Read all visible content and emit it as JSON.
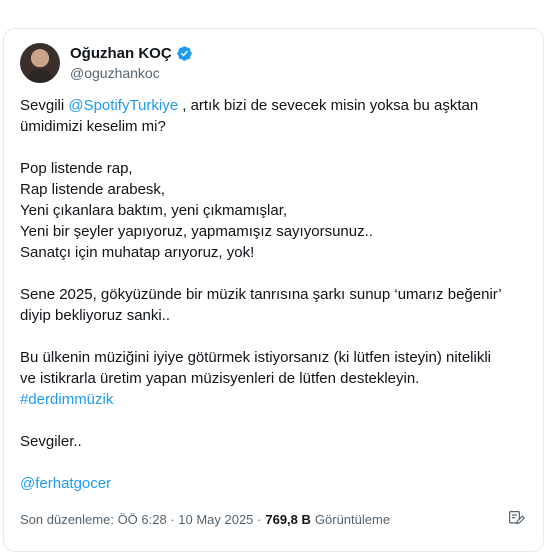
{
  "author": {
    "display_name": "Oğuzhan KOÇ",
    "handle": "@oguzhankoc"
  },
  "post": {
    "p1": {
      "before": "Sevgili ",
      "mention": "@SpotifyTurkiye",
      "after": " , artık bizi de sevecek misin yoksa bu aşktan",
      "line2": "ümidimizi keselim mi?"
    },
    "p2": [
      "Pop listende rap,",
      "Rap listende arabesk,",
      "Yeni çıkanlara baktım, yeni çıkmamışlar,",
      "Yeni bir şeyler yapıyoruz, yapmamışız sayıyorsunuz..",
      "Sanatçı için muhatap arıyoruz, yok!"
    ],
    "p3": [
      "Sene 2025, gökyüzünde bir müzik tanrısına şarkı sunup ‘umarız beğenir’",
      "diyip bekliyoruz sanki.."
    ],
    "p4": [
      "Bu ülkenin müziğini iyiye götürmek istiyorsanız (ki lütfen isteyin) nitelikli",
      "ve istikrarla üretim yapan müzisyenleri de lütfen destekleyin."
    ],
    "hashtag": "#derdimmüzik",
    "closing": "Sevgiler..",
    "mention2": "@ferhatgocer"
  },
  "footer": {
    "edited_label": "Son düzenleme: ÖÖ 6:28 · 10 May 2025 ·",
    "views_count": "769,8 B",
    "views_label": "Görüntüleme"
  },
  "colors": {
    "link": "#1d9bf0",
    "text": "#0f1419",
    "muted": "#536471"
  },
  "icons": {
    "verified": "verified-badge-icon",
    "edit": "edit-history-icon"
  }
}
